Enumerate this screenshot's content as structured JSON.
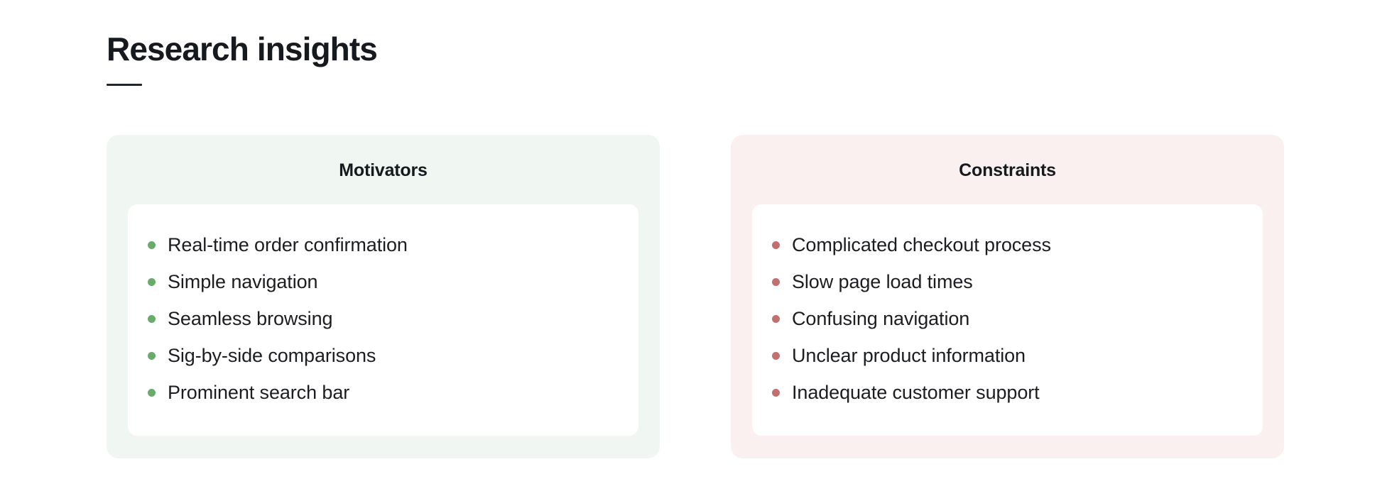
{
  "page": {
    "title": "Research insights",
    "background_color": "#ffffff"
  },
  "cards": [
    {
      "id": "motivators",
      "heading": "Motivators",
      "background_color": "#f0f6f1",
      "bullet_color": "#6aab6a",
      "items": [
        "Real-time order confirmation",
        "Simple navigation",
        "Seamless browsing",
        "Sig-by-side comparisons",
        "Prominent search bar"
      ]
    },
    {
      "id": "constraints",
      "heading": "Constraints",
      "background_color": "#faf0f0",
      "bullet_color": "#c0706f",
      "items": [
        "Complicated checkout process",
        "Slow page load times",
        "Confusing navigation",
        "Unclear product information",
        "Inadequate customer support"
      ]
    }
  ]
}
